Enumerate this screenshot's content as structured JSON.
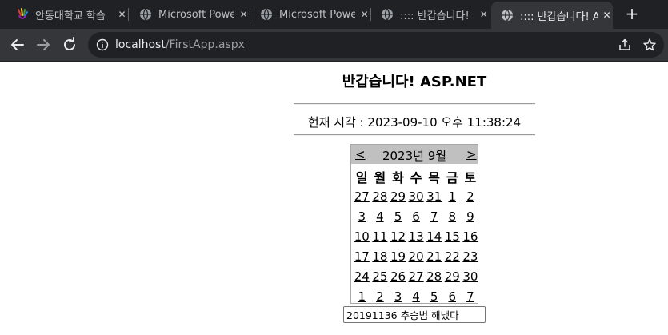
{
  "tabs": [
    {
      "title": "안동대학교 학습",
      "favicon": "colorful-hand-logo-icon",
      "active": false
    },
    {
      "title": "Microsoft Power",
      "favicon": "globe-icon",
      "active": false
    },
    {
      "title": "Microsoft Power",
      "favicon": "globe-icon",
      "active": false
    },
    {
      "title": ":::: 반갑습니다! ",
      "favicon": "globe-icon",
      "active": false
    },
    {
      "title": ":::: 반갑습니다! A",
      "favicon": "globe-icon",
      "active": true
    }
  ],
  "toolbar": {
    "url_host": "localhost",
    "url_path": "/FirstApp.aspx"
  },
  "page": {
    "title": "반갑습니다! ASP.NET",
    "time_label": "현재 시각 : 2023-09-10 오후 11:38:24",
    "input_value": "20191136 추승범 해냈다"
  },
  "calendar": {
    "prev": "<",
    "next": ">",
    "month_title": "2023년 9월",
    "weekdays": [
      "일",
      "월",
      "화",
      "수",
      "목",
      "금",
      "토"
    ],
    "weeks": [
      [
        "27",
        "28",
        "29",
        "30",
        "31",
        "1",
        "2"
      ],
      [
        "3",
        "4",
        "5",
        "6",
        "7",
        "8",
        "9"
      ],
      [
        "10",
        "11",
        "12",
        "13",
        "14",
        "15",
        "16"
      ],
      [
        "17",
        "18",
        "19",
        "20",
        "21",
        "22",
        "23"
      ],
      [
        "24",
        "25",
        "26",
        "27",
        "28",
        "29",
        "30"
      ],
      [
        "1",
        "2",
        "3",
        "4",
        "5",
        "6",
        "7"
      ]
    ]
  },
  "colors": {
    "chrome_dark": "#202124",
    "chrome_toolbar": "#35363a",
    "calendar_header": "#c0c0c0"
  }
}
